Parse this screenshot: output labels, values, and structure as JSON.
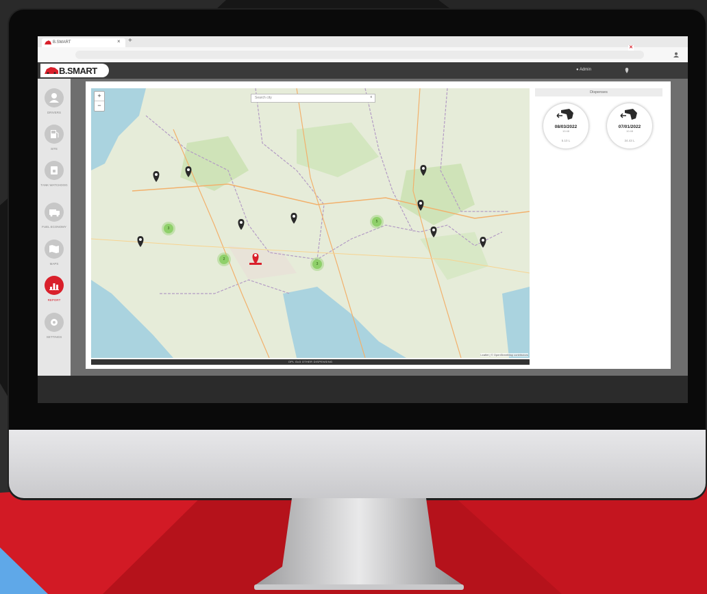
{
  "browser": {
    "tab_title": "B.SMART",
    "tab_close": "×",
    "new_tab": "+"
  },
  "app": {
    "logo_text": "B.SMART",
    "user_name": "Admin"
  },
  "sidebar": {
    "items": [
      {
        "label": "DRIVERS",
        "icon": "driver-icon"
      },
      {
        "label": "SITE",
        "icon": "fuel-pump-icon"
      },
      {
        "label": "TANK WATCHDOG",
        "icon": "tank-icon"
      },
      {
        "label": "FUEL ECONOMY",
        "icon": "truck-icon"
      },
      {
        "label": "MAPS",
        "icon": "map-icon"
      },
      {
        "label": "REPORT",
        "icon": "report-chart-icon",
        "active": true
      },
      {
        "label": "SETTINGS",
        "icon": "gear-icon"
      }
    ]
  },
  "map": {
    "search_placeholder": "Search city",
    "search_clear": "x",
    "zoom_in": "+",
    "zoom_out": "−",
    "attribution": "Leaflet | © OpenStreetMap contributors",
    "footer_label": "OPL Go3 OTHER DISPENSING",
    "clusters": [
      {
        "count": "3"
      },
      {
        "count": "2"
      },
      {
        "count": "5"
      },
      {
        "count": "3"
      }
    ]
  },
  "panel": {
    "title": "Dispenses",
    "dispenses": [
      {
        "date": "08/03/2022",
        "time": "10:48",
        "amount": "5.10 L"
      },
      {
        "date": "07/01/2022",
        "time": "10:48",
        "amount": "34.43 L"
      }
    ]
  },
  "colors": {
    "accent": "#d9202b",
    "cluster": "#8fd06a",
    "marker": "#2a2a2a",
    "appbar": "#3a3a3a"
  }
}
